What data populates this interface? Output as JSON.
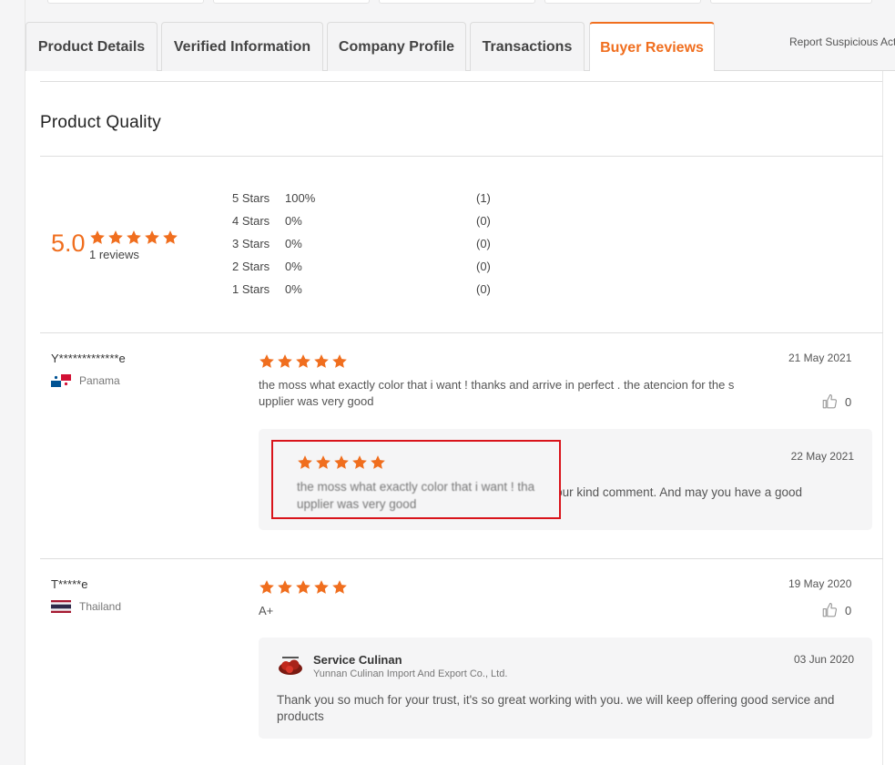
{
  "tabs": [
    {
      "label": "Product Details",
      "active": false
    },
    {
      "label": "Verified Information",
      "active": false
    },
    {
      "label": "Company Profile",
      "active": false
    },
    {
      "label": "Transactions",
      "active": false
    },
    {
      "label": "Buyer Reviews",
      "active": true
    }
  ],
  "report_link": "Report Suspicious Activity",
  "colors": {
    "accent": "#f06e1e",
    "highlight": "#d9141b"
  },
  "product_quality": {
    "title": "Product Quality",
    "score": "5.0",
    "stars": 5,
    "review_count": "1 reviews",
    "distribution": [
      {
        "label": "5  Stars",
        "percent": "100%",
        "count": "(1)"
      },
      {
        "label": "4  Stars",
        "percent": "0%",
        "count": "(0)"
      },
      {
        "label": "3  Stars",
        "percent": "0%",
        "count": "(0)"
      },
      {
        "label": "2  Stars",
        "percent": "0%",
        "count": "(0)"
      },
      {
        "label": "1  Stars",
        "percent": "0%",
        "count": "(0)"
      }
    ]
  },
  "reviews": [
    {
      "reviewer": "Y*************e",
      "country": "Panama",
      "flag_icon": "panama-flag-icon",
      "rating": 5,
      "date": "21 May 2021",
      "text_line1": "the moss what exactly color that i want ! thanks  and arrive in perfect . the atencion for the s",
      "text_line2": "upplier was very good",
      "likes": "0",
      "reply": {
        "date": "22 May 2021",
        "overlay_rating": 5,
        "overlay_line1": "the moss what exactly color that i want ! tha",
        "overlay_line2": "upplier was very good",
        "text": "nd for your kind comment. And may you have a good"
      }
    },
    {
      "reviewer": "T*****e",
      "country": "Thailand",
      "flag_icon": "thailand-flag-icon",
      "rating": 5,
      "date": "19 May 2020",
      "text": "A+",
      "likes": "0",
      "reply": {
        "seller_name": "Service Culinan",
        "seller_company": "Yunnan Culinan Import And Export Co., Ltd.",
        "date": "03 Jun 2020",
        "text_line1": "Thank you so much for your trust,  it's so great working with you. we will keep offering good service and",
        "text_line2": "products"
      }
    }
  ]
}
